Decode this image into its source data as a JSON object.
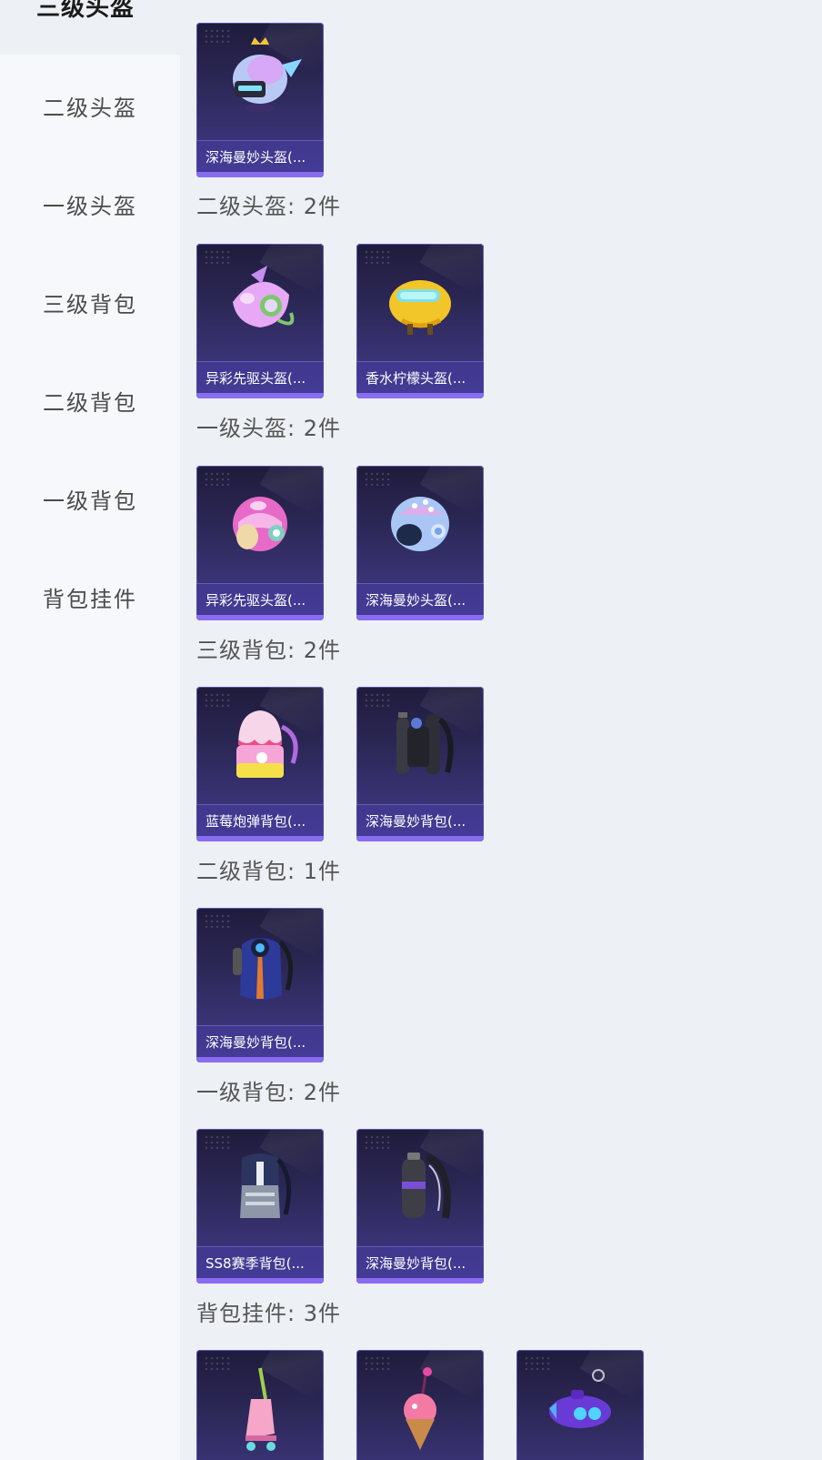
{
  "sidebar": {
    "active_label": "三级头盔",
    "items": [
      {
        "label": "二级头盔"
      },
      {
        "label": "一级头盔"
      },
      {
        "label": "三级背包"
      },
      {
        "label": "二级背包"
      },
      {
        "label": "一级背包"
      },
      {
        "label": "背包挂件"
      }
    ]
  },
  "content": {
    "sections": [
      {
        "title": "",
        "items": [
          {
            "name": "深海曼妙头盔(...",
            "icon": "helmet-crown-icon"
          }
        ]
      },
      {
        "title": "二级头盔: 2件",
        "items": [
          {
            "name": "异彩先驱头盔(...",
            "icon": "helmet-fin-icon"
          },
          {
            "name": "香水柠檬头盔(...",
            "icon": "helmet-goggles-icon"
          }
        ]
      },
      {
        "title": "一级头盔: 2件",
        "items": [
          {
            "name": "异彩先驱头盔(...",
            "icon": "helmet-pink-icon"
          },
          {
            "name": "深海曼妙头盔(...",
            "icon": "helmet-blue-icon"
          }
        ]
      },
      {
        "title": "三级背包: 2件",
        "items": [
          {
            "name": "蓝莓炮弹背包(...",
            "icon": "backpack-cake-icon"
          },
          {
            "name": "深海曼妙背包(...",
            "icon": "backpack-tanks-icon"
          }
        ]
      },
      {
        "title": "二级背包: 1件",
        "items": [
          {
            "name": "深海曼妙背包(...",
            "icon": "backpack-blue-icon"
          }
        ]
      },
      {
        "title": "一级背包: 2件",
        "items": [
          {
            "name": "SS8赛季背包(...",
            "icon": "backpack-striped-icon"
          },
          {
            "name": "深海曼妙背包(...",
            "icon": "backpack-cylinder-icon"
          }
        ]
      },
      {
        "title": "背包挂件: 3件",
        "items": [
          {
            "name": "",
            "icon": "charm-skate-icon"
          },
          {
            "name": "",
            "icon": "charm-icecream-icon"
          },
          {
            "name": "",
            "icon": "charm-submarine-icon"
          }
        ]
      }
    ]
  },
  "colors": {
    "page_bg": "#edf0f5",
    "sidebar_bg": "#f6f8fb",
    "card_top": "#1f1b3b",
    "card_bottom": "#433c8c",
    "accent": "#8a6cf0"
  }
}
